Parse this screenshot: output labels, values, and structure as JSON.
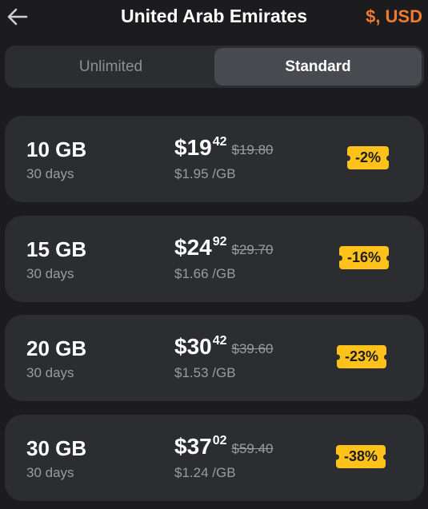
{
  "header": {
    "back_icon": "arrow-left-icon",
    "title": "United Arab Emirates",
    "currency": "$, USD",
    "currency_color": "#f07a2e"
  },
  "tabs": [
    {
      "label": "Unlimited",
      "selected": false
    },
    {
      "label": "Standard",
      "selected": true
    }
  ],
  "plans": [
    {
      "data": "10 GB",
      "duration": "30 days",
      "price_main": "$19",
      "price_cents": "42",
      "price_old": "$19.80",
      "per_gb": "$1.95 /GB",
      "discount": "-2%"
    },
    {
      "data": "15 GB",
      "duration": "30 days",
      "price_main": "$24",
      "price_cents": "92",
      "price_old": "$29.70",
      "per_gb": "$1.66 /GB",
      "discount": "-16%"
    },
    {
      "data": "20 GB",
      "duration": "30 days",
      "price_main": "$30",
      "price_cents": "42",
      "price_old": "$39.60",
      "per_gb": "$1.53 /GB",
      "discount": "-23%"
    },
    {
      "data": "30 GB",
      "duration": "30 days",
      "price_main": "$37",
      "price_cents": "02",
      "price_old": "$59.40",
      "per_gb": "$1.24 /GB",
      "discount": "-38%"
    }
  ],
  "colors": {
    "background": "#1c1c1e",
    "card": "#2c2d31",
    "badge": "#ffc21a"
  }
}
